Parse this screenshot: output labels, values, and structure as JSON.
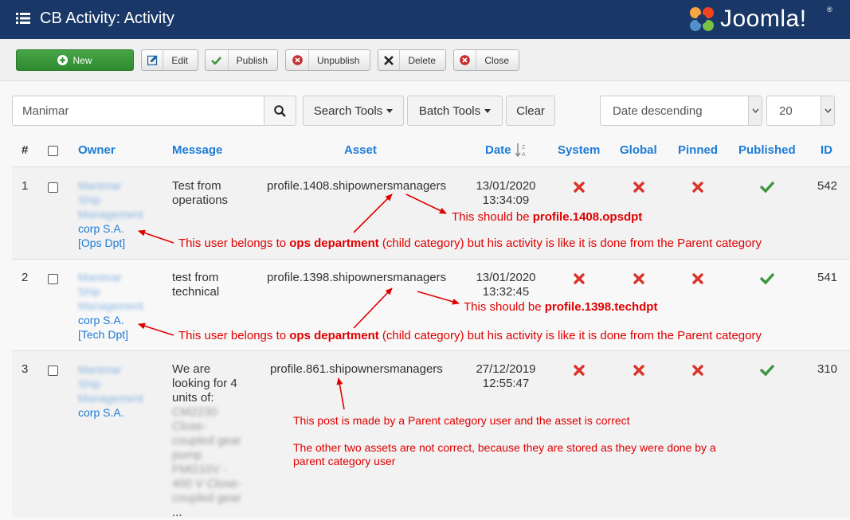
{
  "header": {
    "title": "CB Activity: Activity",
    "logo_text": "Joomla!",
    "logo_mark": "®"
  },
  "toolbar": {
    "new": "New",
    "edit": "Edit",
    "publish": "Publish",
    "unpublish": "Unpublish",
    "delete": "Delete",
    "close": "Close"
  },
  "filters": {
    "search_value": "Manimar",
    "search_tools": "Search Tools",
    "batch_tools": "Batch Tools",
    "clear": "Clear",
    "ordering": "Date descending",
    "limit": "20"
  },
  "table": {
    "columns": {
      "num": "#",
      "owner": "Owner",
      "message": "Message",
      "asset": "Asset",
      "date": "Date",
      "system": "System",
      "global": "Global",
      "pinned": "Pinned",
      "published": "Published",
      "id": "ID"
    },
    "rows": [
      {
        "num": "1",
        "owner_hidden": [
          "Manimar",
          "Ship",
          "Management"
        ],
        "owner_visible": [
          "corp S.A.",
          "[Ops Dpt]"
        ],
        "message": [
          "Test from",
          "operations"
        ],
        "asset": "profile.1408.shipownersmanagers",
        "date": "13/01/2020",
        "time": "13:34:09",
        "id": "542"
      },
      {
        "num": "2",
        "owner_hidden": [
          "Manimar",
          "Ship",
          "Management"
        ],
        "owner_visible": [
          "corp S.A.",
          "[Tech Dpt]"
        ],
        "message": [
          "test from",
          "technical"
        ],
        "asset": "profile.1398.shipownersmanagers",
        "date": "13/01/2020",
        "time": "13:32:45",
        "id": "541"
      },
      {
        "num": "3",
        "owner_hidden": [
          "Manimar",
          "Ship",
          "Management"
        ],
        "owner_visible": [
          "corp S.A."
        ],
        "message": [
          "We are",
          "looking for 4",
          "units of:"
        ],
        "message_hidden": [
          "CM2230",
          "Close-",
          "coupled gear",
          "pump",
          "FMG10V -",
          "400 V Close-",
          "coupled gear",
          "..."
        ],
        "asset": "profile.861.shipownersmanagers",
        "date": "27/12/2019",
        "time": "12:55:47",
        "id": "310"
      }
    ]
  },
  "annotations": {
    "n1_a": "This should be ",
    "n1_b": "profile.1408.opsdpt",
    "n2_a": "This user belongs to ",
    "n2_b": "ops department",
    "n2_c": " (child category) but his activity is like it is done from the Parent category",
    "n3_a": "This should be ",
    "n3_b": "profile.1398.techdpt",
    "n4_a": "This user belongs to ",
    "n4_b": "ops department",
    "n4_c": " (child category) but his activity is like it is done from the Parent category",
    "n5": "This post is made by a Parent category user and the asset is correct",
    "n6_l1": "The other two assets are not correct, because they are stored as they were done by a",
    "n6_l2": "parent category user"
  },
  "colors": {
    "header": "#1a3867",
    "link": "#1e7bd6",
    "annotation": "#e00000",
    "cross": "#d9342b",
    "check": "#3c963c"
  },
  "icons": [
    "menu-icon",
    "joomla-logo-icon",
    "plus-circle-icon",
    "edit-icon",
    "check-icon",
    "unpublish-icon",
    "delete-x-icon",
    "close-icon",
    "search-icon",
    "sort-icon"
  ]
}
